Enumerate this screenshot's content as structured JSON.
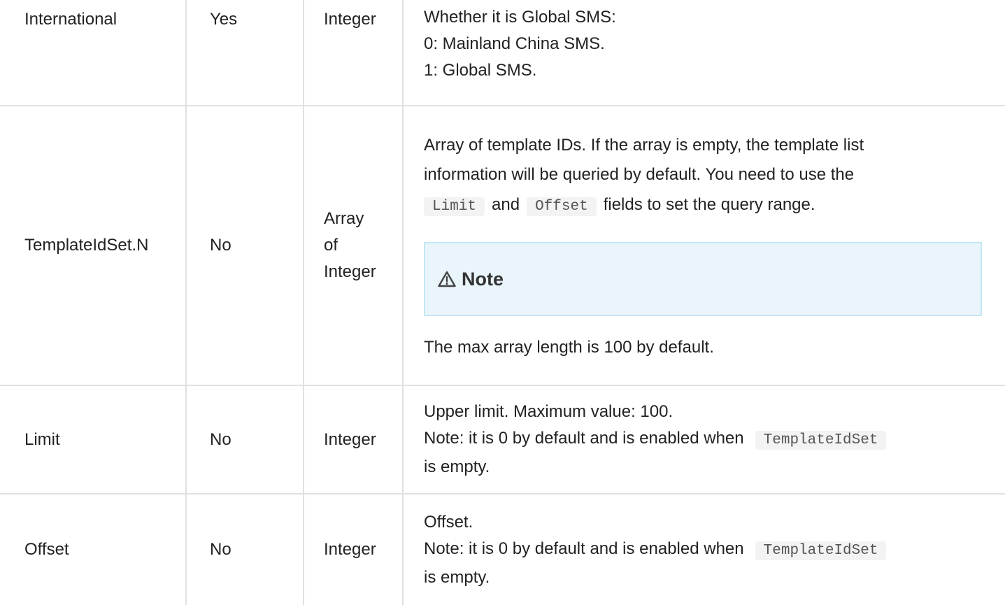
{
  "rows": [
    {
      "name": "International",
      "required": "Yes",
      "type": "Integer",
      "desc_lines": [
        "Whether it is Global SMS:",
        "0: Mainland China SMS.",
        "1: Global SMS."
      ]
    },
    {
      "name": "TemplateIdSet.N",
      "required": "No",
      "type_lines": [
        "Array",
        "of",
        "Integer"
      ],
      "desc_line1": "Array of template IDs. If the array is empty, the template list",
      "desc_line2": "information will be queried by default. You need to use the",
      "code_a": "Limit",
      "joiner": "and",
      "code_b": "Offset",
      "desc_line3_tail": "fields to set the query range.",
      "note_title": "Note",
      "note_icon": "warning-icon",
      "desc_after_note": "The max array length is 100 by default."
    },
    {
      "name": "Limit",
      "required": "No",
      "type": "Integer",
      "desc_line1": "Upper limit. Maximum value: 100.",
      "desc_line2_head": "Note: it is 0 by default and is enabled when",
      "code": "TemplateIdSet",
      "desc_line3": "is empty."
    },
    {
      "name": "Offset",
      "required": "No",
      "type": "Integer",
      "desc_line1": "Offset.",
      "desc_line2_head": "Note: it is 0 by default and is enabled when",
      "code": "TemplateIdSet",
      "desc_line3": "is empty."
    }
  ]
}
